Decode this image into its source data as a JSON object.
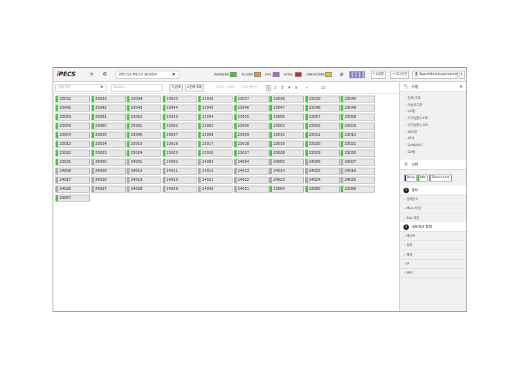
{
  "header": {
    "logo": "iPECS",
    "node_select": "iPECS-CM10.0 NODE4",
    "alarms": [
      {
        "label": "WARNING",
        "color": "#32d32c"
      },
      {
        "label": "ALARM",
        "color": "#f0932b"
      },
      {
        "label": "FAIL",
        "color": "#b060d0"
      },
      {
        "label": "FATAL",
        "color": "#e02020"
      },
      {
        "label": "LINK-DOWN",
        "color": "#e8c81a"
      }
    ],
    "help_btn": "? 도움말",
    "logout_btn": "⇥ 로그아웃",
    "user_btn": "SuperAdmin(superadmin)",
    "user_chevron": "⇕"
  },
  "search": {
    "type_placeholder": "검색 필드",
    "search_placeholder": "Search...",
    "search_btn": "검색",
    "all_btn": "전체 조회",
    "page_info": "1321 / 2/10",
    "page_label": "1/13 페이지",
    "pages": [
      "1",
      "2",
      "3",
      "4",
      "5"
    ],
    "next": "»",
    "last": "13"
  },
  "extensions": [
    {
      "num": "23032",
      "on": true
    },
    {
      "num": "23033",
      "on": true
    },
    {
      "num": "23034",
      "on": true
    },
    {
      "num": "23035",
      "on": true
    },
    {
      "num": "23036",
      "on": true
    },
    {
      "num": "23037",
      "on": true
    },
    {
      "num": "23038",
      "on": true
    },
    {
      "num": "23039",
      "on": true
    },
    {
      "num": "23040",
      "on": true
    },
    {
      "num": "23041",
      "on": true
    },
    {
      "num": "23042",
      "on": true
    },
    {
      "num": "23043",
      "on": true
    },
    {
      "num": "23044",
      "on": true
    },
    {
      "num": "23045",
      "on": true
    },
    {
      "num": "23046",
      "on": true
    },
    {
      "num": "23047",
      "on": true
    },
    {
      "num": "23048",
      "on": true
    },
    {
      "num": "23049",
      "on": true
    },
    {
      "num": "23050",
      "on": true
    },
    {
      "num": "23051",
      "on": true
    },
    {
      "num": "23052",
      "on": true
    },
    {
      "num": "23053",
      "on": true
    },
    {
      "num": "23054",
      "on": true
    },
    {
      "num": "23055",
      "on": true
    },
    {
      "num": "23056",
      "on": true
    },
    {
      "num": "23057",
      "on": true
    },
    {
      "num": "23058",
      "on": true
    },
    {
      "num": "23059",
      "on": true
    },
    {
      "num": "23060",
      "on": true
    },
    {
      "num": "23061",
      "on": true
    },
    {
      "num": "23062",
      "on": true
    },
    {
      "num": "23063",
      "on": true
    },
    {
      "num": "23000",
      "on": true
    },
    {
      "num": "23001",
      "on": true
    },
    {
      "num": "23002",
      "on": true
    },
    {
      "num": "23003",
      "on": true
    },
    {
      "num": "23004",
      "on": true
    },
    {
      "num": "23005",
      "on": true
    },
    {
      "num": "23006",
      "on": true
    },
    {
      "num": "23007",
      "on": true
    },
    {
      "num": "23008",
      "on": true
    },
    {
      "num": "23009",
      "on": true
    },
    {
      "num": "23010",
      "on": true
    },
    {
      "num": "23011",
      "on": true
    },
    {
      "num": "23012",
      "on": true
    },
    {
      "num": "23013",
      "on": true
    },
    {
      "num": "23014",
      "on": true
    },
    {
      "num": "23015",
      "on": true
    },
    {
      "num": "23016",
      "on": true
    },
    {
      "num": "23017",
      "on": true
    },
    {
      "num": "23018",
      "on": true
    },
    {
      "num": "23019",
      "on": true
    },
    {
      "num": "23020",
      "on": true
    },
    {
      "num": "23021",
      "on": true
    },
    {
      "num": "23022",
      "on": true
    },
    {
      "num": "23023",
      "on": true
    },
    {
      "num": "23024",
      "on": true
    },
    {
      "num": "23025",
      "on": true
    },
    {
      "num": "23026",
      "on": true
    },
    {
      "num": "23027",
      "on": true
    },
    {
      "num": "23028",
      "on": true
    },
    {
      "num": "23029",
      "on": true
    },
    {
      "num": "23030",
      "on": true
    },
    {
      "num": "23031",
      "on": true
    },
    {
      "num": "24000",
      "on": false
    },
    {
      "num": "24001",
      "on": false
    },
    {
      "num": "24002",
      "on": false
    },
    {
      "num": "24003",
      "on": false
    },
    {
      "num": "24004",
      "on": false
    },
    {
      "num": "24005",
      "on": false
    },
    {
      "num": "24006",
      "on": false
    },
    {
      "num": "24007",
      "on": false
    },
    {
      "num": "24008",
      "on": false
    },
    {
      "num": "24009",
      "on": false
    },
    {
      "num": "24010",
      "on": false
    },
    {
      "num": "24011",
      "on": false
    },
    {
      "num": "24012",
      "on": false
    },
    {
      "num": "24013",
      "on": false
    },
    {
      "num": "24014",
      "on": false
    },
    {
      "num": "24015",
      "on": false
    },
    {
      "num": "24016",
      "on": false
    },
    {
      "num": "24017",
      "on": false
    },
    {
      "num": "24018",
      "on": false
    },
    {
      "num": "24019",
      "on": false
    },
    {
      "num": "24020",
      "on": false
    },
    {
      "num": "24021",
      "on": false
    },
    {
      "num": "24022",
      "on": false
    },
    {
      "num": "24023",
      "on": false
    },
    {
      "num": "24024",
      "on": false
    },
    {
      "num": "24025",
      "on": false
    },
    {
      "num": "24026",
      "on": false
    },
    {
      "num": "24027",
      "on": false
    },
    {
      "num": "24028",
      "on": false
    },
    {
      "num": "24029",
      "on": false
    },
    {
      "num": "24030",
      "on": false
    },
    {
      "num": "24031",
      "on": false
    },
    {
      "num": "23064",
      "on": true
    },
    {
      "num": "23065",
      "on": true
    },
    {
      "num": "23066",
      "on": true
    },
    {
      "num": "23067",
      "on": true
    }
  ],
  "panel": {
    "type_title": "유형",
    "type_items": [
      "전체 조회",
      "아날로그폰",
      "LIP폰",
      "디지털폰(LKD)",
      "디지털폰(LGP)",
      "WiFi폰",
      "ATD",
      "Soft폰/UC",
      "SIP폰"
    ],
    "status_title": "상태",
    "status_buttons": [
      {
        "label": "Busy",
        "color": "#2020c0"
      },
      {
        "label": "Idle",
        "color": "#32d32c"
      },
      {
        "label": "Disconnect",
        "color": "#9a9a9a"
      }
    ],
    "info_title": "정보",
    "info_items": [
      "전화번호",
      "Main 타입",
      "Sub 타입"
    ],
    "net_title": "네트워크 정보",
    "net_items": [
      "테넌트",
      "슬롯",
      "채널",
      "IP",
      "MAC"
    ],
    "icon_info": "i"
  }
}
